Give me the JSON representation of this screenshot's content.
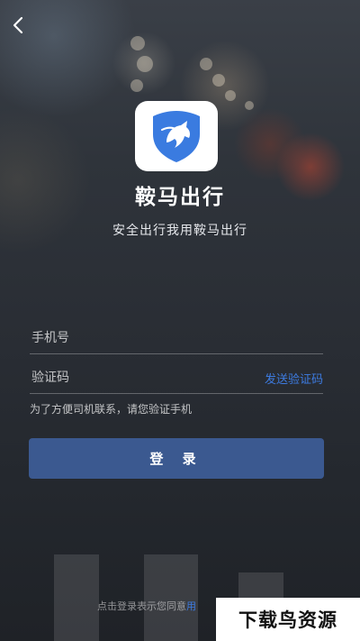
{
  "app": {
    "name": "鞍马出行",
    "slogan": "安全出行我用鞍马出行"
  },
  "nav": {
    "back_icon": "chevron-left-icon"
  },
  "logo": {
    "icon": "shield-horse-logo",
    "color": "#3a7be0"
  },
  "form": {
    "phone": {
      "placeholder": "手机号",
      "value": ""
    },
    "code": {
      "placeholder": "验证码",
      "value": ""
    },
    "send_code_label": "发送验证码",
    "hint": "为了方便司机联系，请您验证手机"
  },
  "login_button": {
    "label": "登 录"
  },
  "footer": {
    "agreement_text": "点击登录表示您同意",
    "agreement_link": "用"
  },
  "watermark": {
    "text": "下载鸟资源"
  },
  "colors": {
    "accent": "#3d7be0",
    "button": "#3b5990",
    "text": "#ffffff"
  }
}
